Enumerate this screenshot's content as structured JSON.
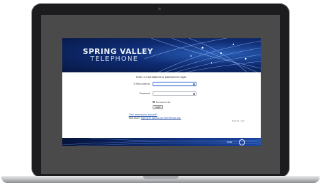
{
  "brand": {
    "line1": "SPRING VALLEY",
    "line2": "TELEPHONE"
  },
  "login": {
    "instructions": "Enter e-mail address & password to login.",
    "email_label": "E-Mail Address",
    "email_value": "",
    "password_label": "Password",
    "password_value": "",
    "remember_label": "Remember Me",
    "login_button": "Login",
    "cant_access": "Can't access your account?",
    "new_user_prefix": "New User?",
    "new_user_link": "Sign up to access our Self Service site.",
    "powered_by": "Powered · Calix"
  },
  "footer": {
    "partner_text": "Calix"
  },
  "colors": {
    "banner_dark": "#061742",
    "banner_mid": "#0f2c74",
    "link": "#1f4fa8",
    "device_frame": "#1c1c1e",
    "screen_bezel": "#4a4a4a"
  },
  "icons": {
    "email_field_icon": "id-card-icon",
    "password_field_icon": "key-icon",
    "footer_logo": "circle-logo-icon"
  }
}
